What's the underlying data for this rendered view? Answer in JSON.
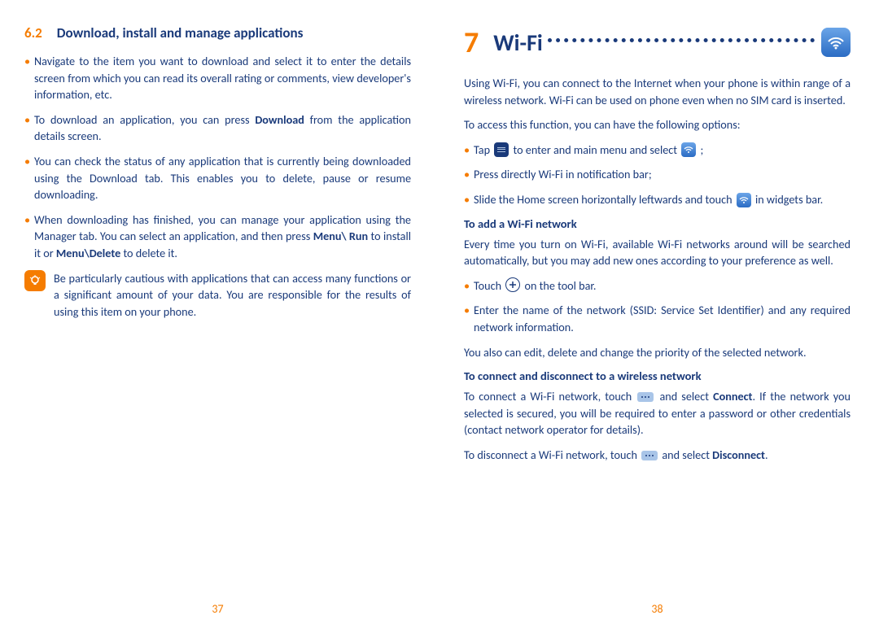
{
  "left": {
    "section_num": "6.2",
    "section_title": "Download, install and manage applications",
    "bullets": [
      "Navigate to the item you want to download and select it to enter the details screen from which you can read its overall rating or comments, view developer's information, etc.",
      "To download an application, you can press <b>Download</b> from the application details screen.",
      "You can check the status of any application that is currently being downloaded using the Download tab. This enables you to delete, pause or resume downloading.",
      "When downloading has finished, you can manage your application using the Manager tab. You can select an application, and then press <b>Menu\\ Run</b> to install it or <b>Menu\\Delete</b> to delete it."
    ],
    "note": "Be particularly cautious with applications that can access many functions or a significant amount of your data. You are responsible for the results of using this item on your phone.",
    "page": "37"
  },
  "right": {
    "chapter_num": "7",
    "chapter_title": "Wi-Fi",
    "intro": "Using Wi-Fi, you can connect to the Internet when your phone is within range of a wireless network. Wi-Fi can be used on phone even when no SIM card is inserted.",
    "access_line": "To access this function, you can have the following options:",
    "access_b1_a": "Tap ",
    "access_b1_b": " to enter and main menu and select ",
    "access_b1_c": ";",
    "access_b2": "Press directly Wi-Fi in notification bar;",
    "access_b3_a": "Slide the Home screen horizontally leftwards and touch ",
    "access_b3_b": " in widgets bar.",
    "sub_add": "To add a Wi-Fi network",
    "add_para": "Every time you turn on Wi-Fi, available Wi-Fi networks around will be searched automatically, but you may add new ones according to your preference as well.",
    "add_b1_a": "Touch ",
    "add_b1_b": " on the tool bar.",
    "add_b2": "Enter the name of the network (SSID: Service Set Identifier) and any required network information.",
    "add_para2": "You also can edit, delete and change the priority of the selected network.",
    "sub_conn": "To connect and disconnect to a wireless network",
    "conn_p1_a": "To connect a Wi-Fi network, touch ",
    "conn_p1_b": " and select <b>Connect</b>. If the network you selected is secured, you will be required to enter a password or other credentials (contact network operator for details).",
    "conn_p2_a": "To disconnect a Wi-Fi network, touch ",
    "conn_p2_b": " and select <b>Disconnect</b>.",
    "page": "38"
  }
}
